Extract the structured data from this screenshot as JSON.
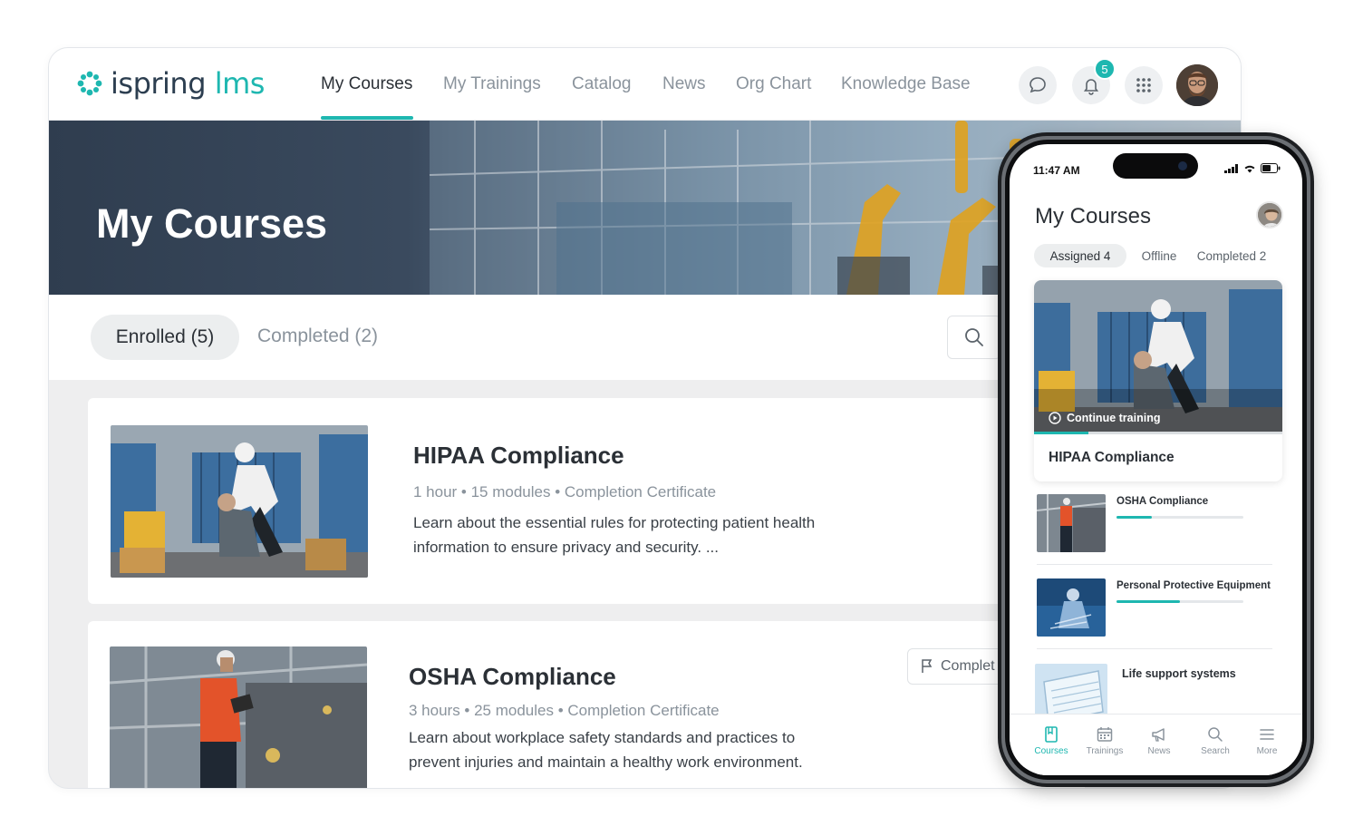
{
  "desktop": {
    "logo": {
      "word1": "ispring",
      "word2": "lms"
    },
    "nav": [
      {
        "label": "My Courses"
      },
      {
        "label": "My Trainings"
      },
      {
        "label": "Catalog"
      },
      {
        "label": "News"
      },
      {
        "label": "Org Chart"
      },
      {
        "label": "Knowledge Base"
      }
    ],
    "notifications_count": "5",
    "hero_title": "My Courses",
    "tabs": {
      "enrolled": "Enrolled (5)",
      "completed": "Completed (2)"
    },
    "courses": [
      {
        "title": "HIPAA Compliance",
        "meta": "1 hour  •  15 modules  •  Completion Certificate",
        "description": "Learn about the essential rules for protecting patient health information to ensure privacy and security. ..."
      },
      {
        "title": "OSHA Compliance",
        "meta": "3 hours  •  25 modules  •  Completion Certificate",
        "description": "Learn about workplace safety standards and practices to prevent injuries and maintain a healthy work environment."
      }
    ],
    "complete_button": "Complet"
  },
  "phone": {
    "time": "11:47 AM",
    "title": "My Courses",
    "tabs": [
      {
        "label": "Assigned 4"
      },
      {
        "label": "Offline"
      },
      {
        "label": "Completed 2"
      }
    ],
    "featured": {
      "continue_label": "Continue training",
      "title": "HIPAA Compliance",
      "progress": 0.22
    },
    "items": [
      {
        "title": "OSHA Compliance",
        "progress": 0.28
      },
      {
        "title": "Personal Protective Equipment",
        "progress": 0.5
      },
      {
        "title": "Life support systems",
        "progress": 0
      }
    ],
    "tabbar": [
      {
        "label": "Courses",
        "icon": "book-icon"
      },
      {
        "label": "Trainings",
        "icon": "calendar-icon"
      },
      {
        "label": "News",
        "icon": "megaphone-icon"
      },
      {
        "label": "Search",
        "icon": "search-icon"
      },
      {
        "label": "More",
        "icon": "menu-icon"
      }
    ]
  },
  "colors": {
    "accent": "#1eb7b0",
    "text": "#2b3036",
    "muted": "#8a939c"
  }
}
